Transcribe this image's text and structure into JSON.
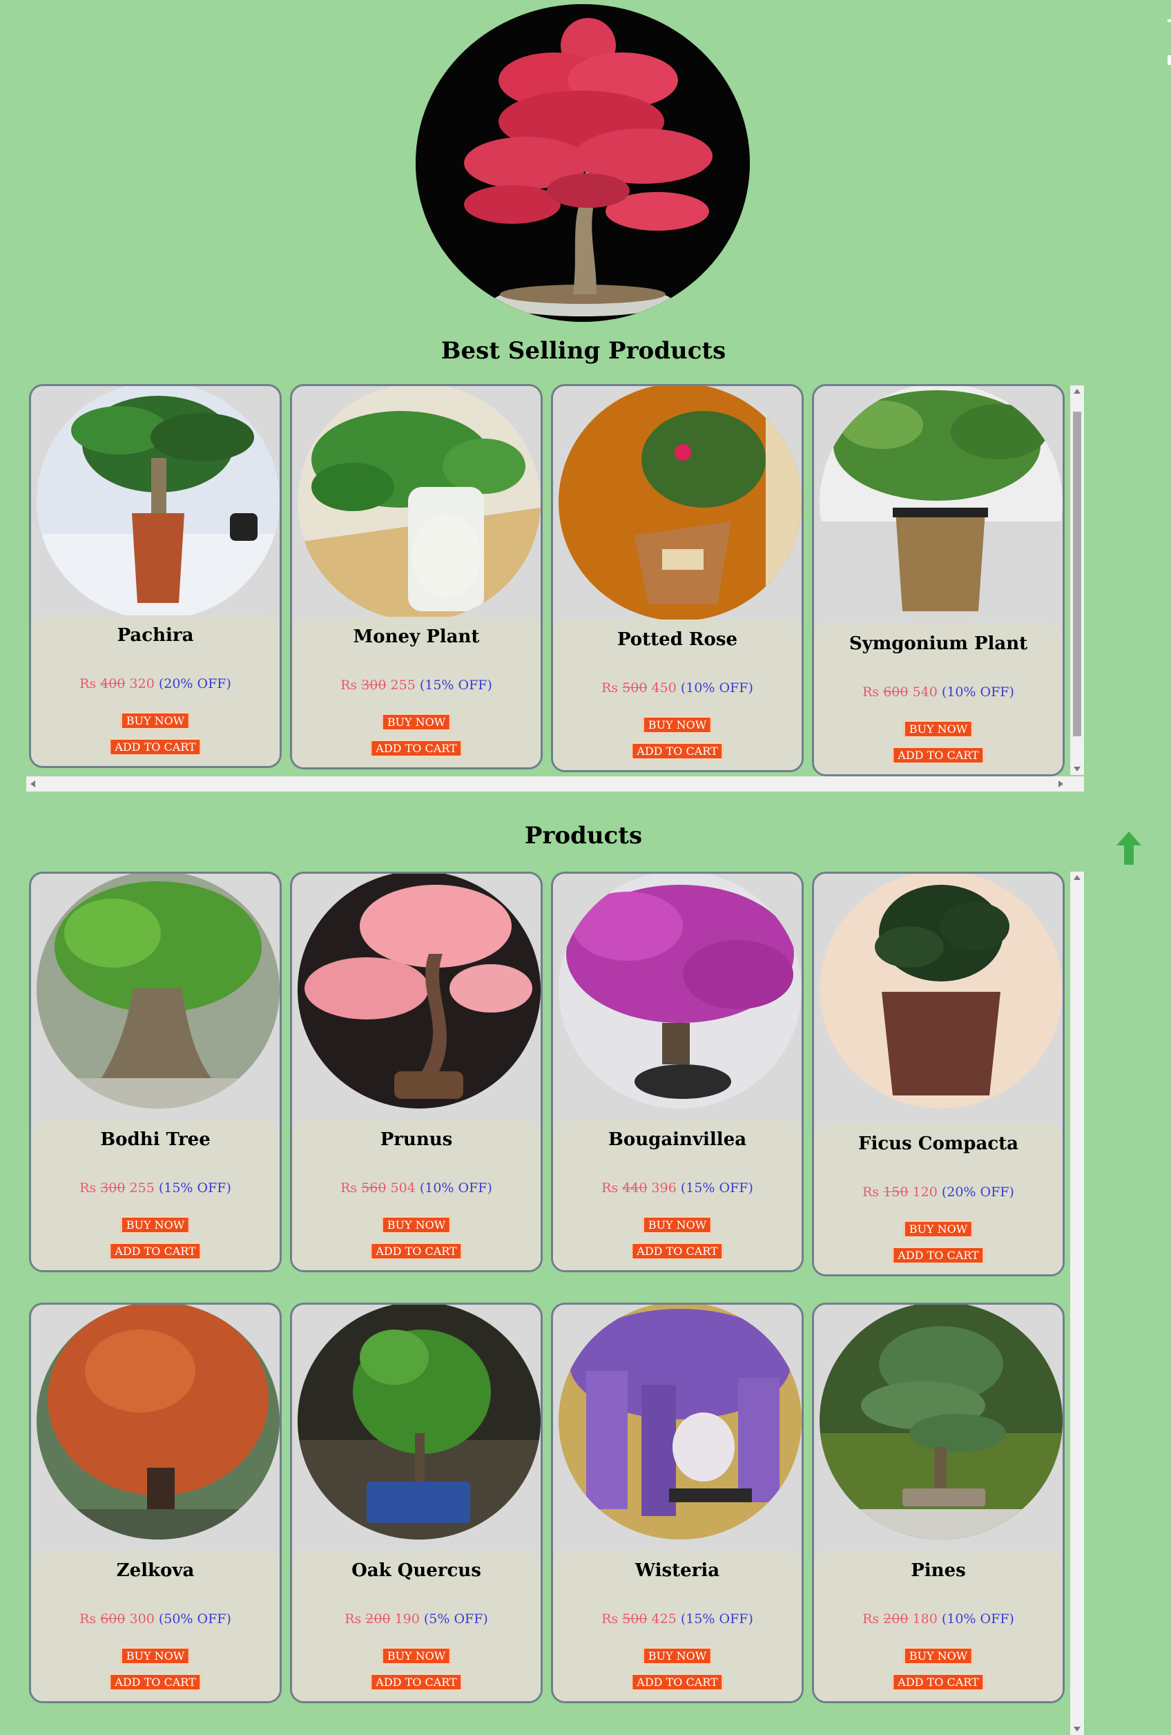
{
  "best_selling": {
    "title": "Best Selling Products",
    "products": [
      {
        "name": "Pachira",
        "currency": "Rs",
        "old_price": "400",
        "new_price": "320",
        "discount": "(20% OFF)",
        "buy_label": "BUY NOW",
        "cart_label": "ADD TO CART"
      },
      {
        "name": "Money Plant",
        "currency": "Rs",
        "old_price": "300",
        "new_price": "255",
        "discount": "(15% OFF)",
        "buy_label": "BUY NOW",
        "cart_label": "ADD TO CART"
      },
      {
        "name": "Potted Rose",
        "currency": "Rs",
        "old_price": "500",
        "new_price": "450",
        "discount": "(10% OFF)",
        "buy_label": "BUY NOW",
        "cart_label": "ADD TO CART"
      },
      {
        "name": "Symgonium Plant",
        "currency": "Rs",
        "old_price": "600",
        "new_price": "540",
        "discount": "(10% OFF)",
        "buy_label": "BUY NOW",
        "cart_label": "ADD TO CART"
      }
    ]
  },
  "products": {
    "title": "Products",
    "items": [
      {
        "name": "Bodhi Tree",
        "currency": "Rs",
        "old_price": "300",
        "new_price": "255",
        "discount": "(15% OFF)",
        "buy_label": "BUY NOW",
        "cart_label": "ADD TO CART"
      },
      {
        "name": "Prunus",
        "currency": "Rs",
        "old_price": "560",
        "new_price": "504",
        "discount": "(10% OFF)",
        "buy_label": "BUY NOW",
        "cart_label": "ADD TO CART"
      },
      {
        "name": "Bougainvillea",
        "currency": "Rs",
        "old_price": "440",
        "new_price": "396",
        "discount": "(15% OFF)",
        "buy_label": "BUY NOW",
        "cart_label": "ADD TO CART"
      },
      {
        "name": "Ficus Compacta",
        "currency": "Rs",
        "old_price": "150",
        "new_price": "120",
        "discount": "(20% OFF)",
        "buy_label": "BUY NOW",
        "cart_label": "ADD TO CART"
      },
      {
        "name": "Zelkova",
        "currency": "Rs",
        "old_price": "600",
        "new_price": "300",
        "discount": "(50% OFF)",
        "buy_label": "BUY NOW",
        "cart_label": "ADD TO CART"
      },
      {
        "name": "Oak Quercus",
        "currency": "Rs",
        "old_price": "200",
        "new_price": "190",
        "discount": "(5% OFF)",
        "buy_label": "BUY NOW",
        "cart_label": "ADD TO CART"
      },
      {
        "name": "Wisteria",
        "currency": "Rs",
        "old_price": "500",
        "new_price": "425",
        "discount": "(15% OFF)",
        "buy_label": "BUY NOW",
        "cart_label": "ADD TO CART"
      },
      {
        "name": "Pines",
        "currency": "Rs",
        "old_price": "200",
        "new_price": "180",
        "discount": "(10% OFF)",
        "buy_label": "BUY NOW",
        "cart_label": "ADD TO CART"
      }
    ]
  },
  "colors": {
    "page_background": "#9cd69a",
    "button_background": "#ee4d1a",
    "price_color": "#e8596b",
    "discount_color": "#3b3bd6"
  },
  "icons": {
    "back_to_top": "up-arrow-icon"
  }
}
